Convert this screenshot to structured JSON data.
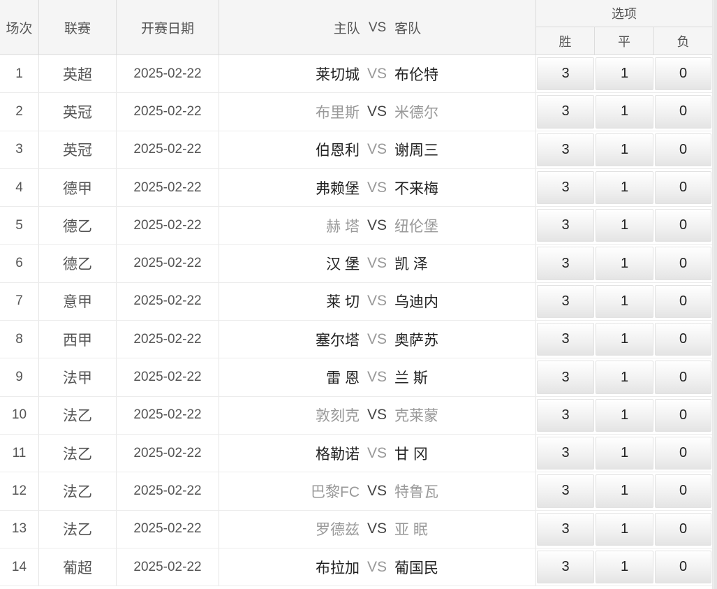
{
  "header": {
    "no": "场次",
    "league": "联赛",
    "date": "开赛日期",
    "home": "主队",
    "vs": "VS",
    "away": "客队",
    "options_title": "选项",
    "opt_win": "胜",
    "opt_draw": "平",
    "opt_lose": "负"
  },
  "rows": [
    {
      "no": "1",
      "league": "英超",
      "date": "2025-02-22",
      "home": "莱切城",
      "vs": "VS",
      "away": "布伦特",
      "win": "3",
      "draw": "1",
      "lose": "0",
      "muted": false
    },
    {
      "no": "2",
      "league": "英冠",
      "date": "2025-02-22",
      "home": "布里斯",
      "vs": "VS",
      "away": "米德尔",
      "win": "3",
      "draw": "1",
      "lose": "0",
      "muted": true
    },
    {
      "no": "3",
      "league": "英冠",
      "date": "2025-02-22",
      "home": "伯恩利",
      "vs": "VS",
      "away": "谢周三",
      "win": "3",
      "draw": "1",
      "lose": "0",
      "muted": false
    },
    {
      "no": "4",
      "league": "德甲",
      "date": "2025-02-22",
      "home": "弗赖堡",
      "vs": "VS",
      "away": "不来梅",
      "win": "3",
      "draw": "1",
      "lose": "0",
      "muted": false
    },
    {
      "no": "5",
      "league": "德乙",
      "date": "2025-02-22",
      "home": "赫 塔",
      "vs": "VS",
      "away": "纽伦堡",
      "win": "3",
      "draw": "1",
      "lose": "0",
      "muted": true
    },
    {
      "no": "6",
      "league": "德乙",
      "date": "2025-02-22",
      "home": "汉 堡",
      "vs": "VS",
      "away": "凯 泽",
      "win": "3",
      "draw": "1",
      "lose": "0",
      "muted": false
    },
    {
      "no": "7",
      "league": "意甲",
      "date": "2025-02-22",
      "home": "莱 切",
      "vs": "VS",
      "away": "乌迪内",
      "win": "3",
      "draw": "1",
      "lose": "0",
      "muted": false
    },
    {
      "no": "8",
      "league": "西甲",
      "date": "2025-02-22",
      "home": "塞尔塔",
      "vs": "VS",
      "away": "奥萨苏",
      "win": "3",
      "draw": "1",
      "lose": "0",
      "muted": false
    },
    {
      "no": "9",
      "league": "法甲",
      "date": "2025-02-22",
      "home": "雷 恩",
      "vs": "VS",
      "away": "兰 斯",
      "win": "3",
      "draw": "1",
      "lose": "0",
      "muted": false
    },
    {
      "no": "10",
      "league": "法乙",
      "date": "2025-02-22",
      "home": "敦刻克",
      "vs": "VS",
      "away": "克莱蒙",
      "win": "3",
      "draw": "1",
      "lose": "0",
      "muted": true
    },
    {
      "no": "11",
      "league": "法乙",
      "date": "2025-02-22",
      "home": "格勒诺",
      "vs": "VS",
      "away": "甘 冈",
      "win": "3",
      "draw": "1",
      "lose": "0",
      "muted": false
    },
    {
      "no": "12",
      "league": "法乙",
      "date": "2025-02-22",
      "home": "巴黎FC",
      "vs": "VS",
      "away": "特鲁瓦",
      "win": "3",
      "draw": "1",
      "lose": "0",
      "muted": true
    },
    {
      "no": "13",
      "league": "法乙",
      "date": "2025-02-22",
      "home": "罗德兹",
      "vs": "VS",
      "away": "亚 眠",
      "win": "3",
      "draw": "1",
      "lose": "0",
      "muted": true
    },
    {
      "no": "14",
      "league": "葡超",
      "date": "2025-02-22",
      "home": "布拉加",
      "vs": "VS",
      "away": "葡国民",
      "win": "3",
      "draw": "1",
      "lose": "0",
      "muted": false
    }
  ]
}
